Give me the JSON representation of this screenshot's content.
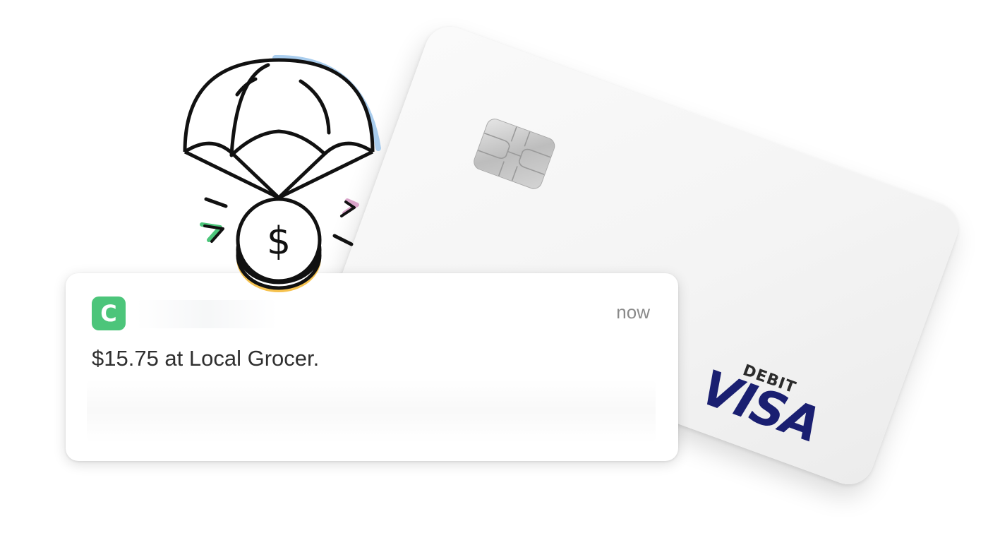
{
  "notification": {
    "app_icon_letter": "C",
    "timestamp": "now",
    "message": "$15.75 at Local Grocer."
  },
  "card": {
    "type_label": "DEBIT",
    "network": "VISA"
  },
  "illustration": {
    "coin_symbol": "$",
    "icon": "parachute-money-icon"
  },
  "colors": {
    "app_icon": "#4cc57a",
    "visa_blue": "#1a1f71",
    "parachute_accent": "#a9cdee",
    "coin_accent": "#f6c24f",
    "spark_green": "#4cc57a",
    "spark_pink": "#d9a4c9"
  }
}
